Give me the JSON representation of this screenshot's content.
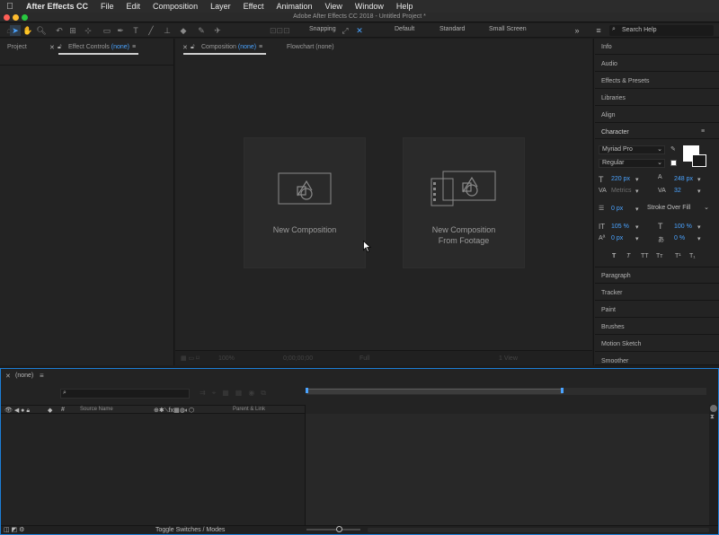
{
  "menubar": {
    "app_name": "After Effects CC",
    "items": [
      "File",
      "Edit",
      "Composition",
      "Layer",
      "Effect",
      "Animation",
      "View",
      "Window",
      "Help"
    ]
  },
  "window": {
    "title": "Adobe After Effects CC 2018 - Untitled Project *"
  },
  "toolbar": {
    "snapping_label": "Snapping",
    "workspaces": [
      "Default",
      "Standard",
      "Small Screen"
    ],
    "search_placeholder": "Search Help"
  },
  "left_panel": {
    "tabs": [
      {
        "label": "Project"
      },
      {
        "label": "Effect Controls",
        "suffix": "(none)"
      }
    ]
  },
  "comp_panel": {
    "tabs": [
      {
        "label": "Composition",
        "suffix": "(none)"
      },
      {
        "label": "Flowchart (none)"
      }
    ],
    "cards": [
      {
        "line1": "New Composition",
        "line2": ""
      },
      {
        "line1": "New Composition",
        "line2": "From Footage"
      }
    ],
    "footer": {
      "zoom": "100%",
      "timecode": "0;00;00;00",
      "resolution": "Full",
      "view": "1 View"
    }
  },
  "right_panel": {
    "items_top": [
      "Info",
      "Audio",
      "Effects & Presets",
      "Libraries",
      "Align"
    ],
    "character": {
      "title": "Character",
      "font": "Myriad Pro",
      "style": "Regular",
      "size": "220 px",
      "leading": "248 px",
      "kerning": "Metrics",
      "tracking": "32",
      "stroke_width": "0 px",
      "stroke_mode": "Stroke Over Fill",
      "vscale": "105 %",
      "hscale": "100 %",
      "baseline": "0 px",
      "tsume": "0 %",
      "styles": [
        "T",
        "T",
        "TT",
        "Tт",
        "T¹",
        "T₁"
      ]
    },
    "items_bottom": [
      "Paragraph",
      "Tracker",
      "Paint",
      "Brushes",
      "Motion Sketch",
      "Smoother"
    ]
  },
  "timeline": {
    "tab_label": "(none)",
    "columns": {
      "source_name": "Source Name",
      "parent": "Parent & Link"
    },
    "footer_label": "Toggle Switches / Modes"
  },
  "colors": {
    "accent": "#4aa3ff",
    "panel_bg": "#232323",
    "timeline_border": "#1c7ed6"
  }
}
